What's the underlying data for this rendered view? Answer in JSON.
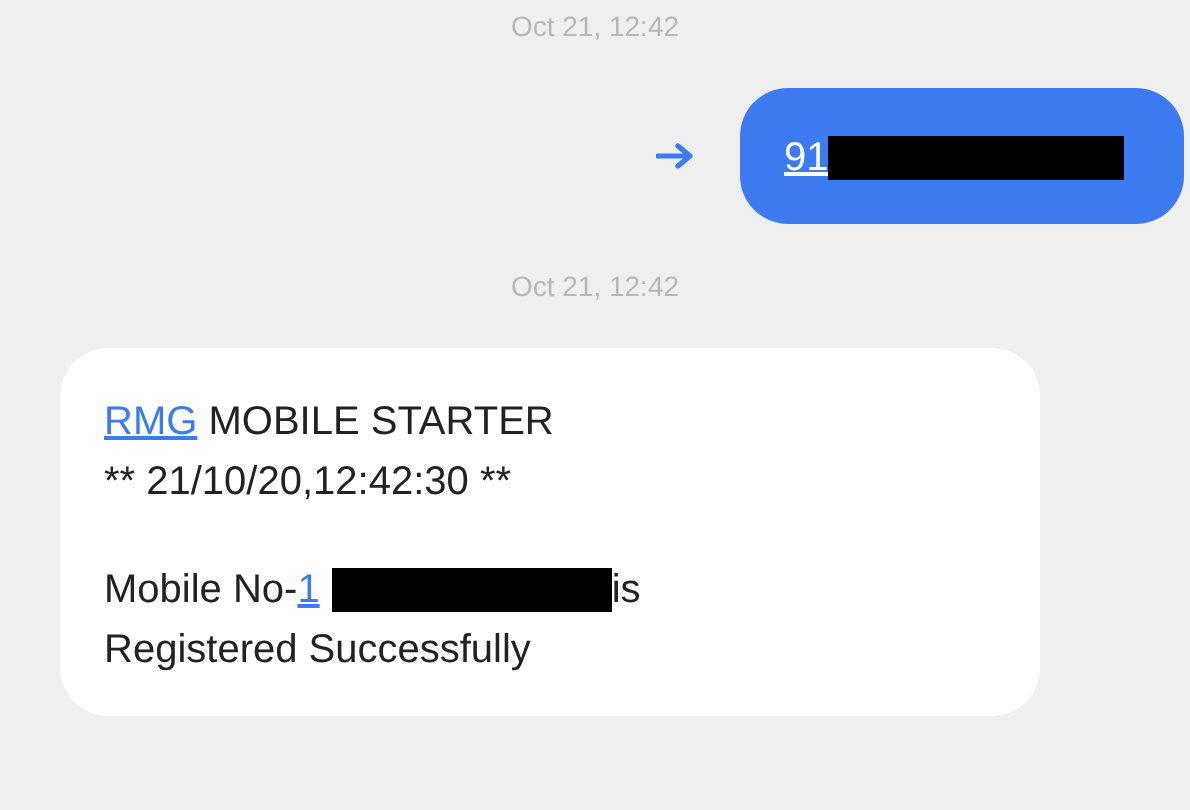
{
  "messages": [
    {
      "kind": "timestamp",
      "text": "Oct 21, 12:42"
    },
    {
      "kind": "outgoing",
      "lines": [
        [
          {
            "kind": "link",
            "text": "91"
          },
          {
            "kind": "redacted"
          }
        ]
      ]
    },
    {
      "kind": "timestamp",
      "text": "Oct 21, 12:42"
    },
    {
      "kind": "incoming",
      "lines": [
        [
          {
            "kind": "link",
            "text": "RMG"
          },
          {
            "kind": "text",
            "text": " MOBILE STARTER"
          }
        ],
        [
          {
            "kind": "text",
            "text": "** 21/10/20,12:42:30 **"
          }
        ],
        [
          {
            "kind": "gap"
          }
        ],
        [
          {
            "kind": "text",
            "text": "Mobile No-"
          },
          {
            "kind": "link",
            "text": "1"
          },
          {
            "kind": "redacted"
          },
          {
            "kind": "text",
            "text": "is"
          }
        ],
        [
          {
            "kind": "text",
            "text": "Registered Successfully"
          }
        ]
      ]
    }
  ]
}
